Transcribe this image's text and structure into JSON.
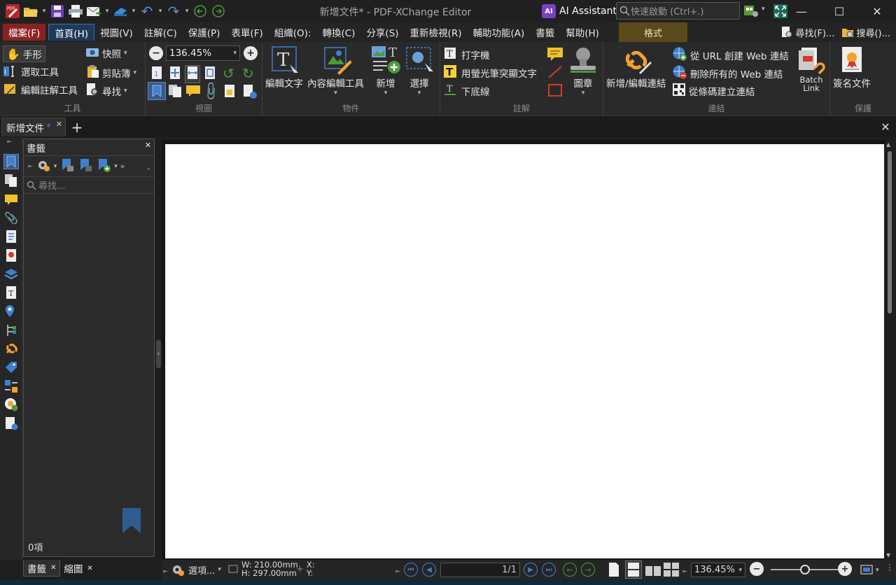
{
  "titlebar": {
    "title": "新增文件* - PDF-XChange Editor",
    "ai_assistant": "AI Assistant",
    "ai_badge": "AI",
    "quick_launch_placeholder": "快速啟動 (Ctrl+.)"
  },
  "menu": {
    "items": [
      "檔案(F)",
      "首頁(H)",
      "視圖(V)",
      "註解(C)",
      "保護(P)",
      "表單(F)",
      "組織(O):",
      "轉換(C)",
      "分享(S)",
      "重新檢視(R)",
      "輔助功能(A)",
      "書籤",
      "幫助(H)"
    ],
    "format_tab": "格式",
    "find": "尋找(F)...",
    "search": "搜尋()..."
  },
  "ribbon": {
    "tools": {
      "label": "工具",
      "hand": "手形",
      "select": "選取工具",
      "edit_annot": "編輯註解工具",
      "snapshot": "快照",
      "clipboard": "剪貼簿",
      "find": "尋找"
    },
    "view": {
      "label": "視圖",
      "zoom": "136.45%"
    },
    "objects": {
      "label": "物件",
      "edit_text": "編輯文字",
      "content_edit": "內容編輯工具",
      "add": "新增",
      "select": "選擇"
    },
    "comments": {
      "label": "註解",
      "typewriter": "打字機",
      "highlight": "用螢光筆突顯文字",
      "underline": "下底線",
      "stamp": "圖章"
    },
    "links": {
      "label": "連結",
      "add_edit": "新增/編輯連結",
      "create_web": "從 URL 創建 Web 連結",
      "remove_web": "刪除所有的 Web 連結",
      "qr_link": "從條碼建立連結",
      "batch": "Batch Link"
    },
    "protect": {
      "label": "保護",
      "sign": "簽名文件"
    }
  },
  "doc_tab": {
    "name": "新增文件",
    "modified": "*"
  },
  "bookmarks": {
    "title": "書籤",
    "search_placeholder": "尋找...",
    "count": "0項"
  },
  "panel_tabs": [
    "書籤",
    "縮圖"
  ],
  "status": {
    "options": "選項...",
    "width": "W: 210.00mm",
    "height": "H: 297.00mm",
    "x": "X:",
    "y": "Y:",
    "page": "1/1",
    "zoom": "136.45%"
  },
  "colors": {
    "file_menu": "#8b2222",
    "format_tab": "#5a4a1a",
    "accent_blue": "#3f7fd0",
    "nav_green": "#4c9a3c"
  }
}
